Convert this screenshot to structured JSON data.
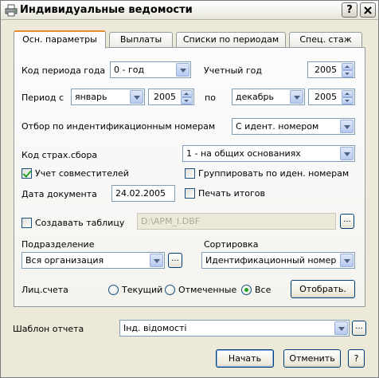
{
  "window": {
    "title": "Индивидуальные ведомости",
    "help_label": "?",
    "close_label": "X"
  },
  "tabs": [
    {
      "label": "Осн. параметры",
      "active": true
    },
    {
      "label": "Выплаты",
      "active": false
    },
    {
      "label": "Списки по периодам",
      "active": false
    },
    {
      "label": "Спец. стаж",
      "active": false
    }
  ],
  "form": {
    "period_code_label": "Код периода года",
    "period_code_value": "0 - год",
    "fiscal_year_label": "Учетный год",
    "fiscal_year_value": "2005",
    "period_from_label": "Период с",
    "period_from_month": "январь",
    "period_from_year": "2005",
    "period_to_label": "по",
    "period_to_month": "декабрь",
    "period_to_year": "2005",
    "id_filter_label": "Отбор по индентификационным номерам",
    "id_filter_value": "С идент. номером",
    "insurance_code_label": "Код страх.сбора",
    "insurance_code_value": "1 - на общих основаниях",
    "part_timers_label": "Учет совместителей",
    "part_timers_checked": true,
    "group_by_id_label": "Группировать по иден. номерам",
    "group_by_id_checked": false,
    "doc_date_label": "Дата документа",
    "doc_date_value": "24.02.2005",
    "print_totals_label": "Печать итогов",
    "print_totals_checked": false,
    "create_table_label": "Создавать таблицу",
    "create_table_checked": false,
    "create_table_path": "D:\\APM_I.DBF",
    "browse_label": "...",
    "department_label": "Подразделение",
    "department_value": "Вся организация",
    "sort_label": "Сортировка",
    "sort_value": "Идентификационный номер",
    "accounts_label": "Лиц.счета",
    "radio_current": "Текущий",
    "radio_marked": "Отмеченные",
    "radio_all": "Все",
    "radio_selected": "all",
    "select_button": "Отобрать."
  },
  "footer": {
    "template_label": "Шаблон отчета",
    "template_value": "Інд. відомості",
    "start_button": "Начать",
    "cancel_button": "Отменить",
    "help_button": "?"
  }
}
